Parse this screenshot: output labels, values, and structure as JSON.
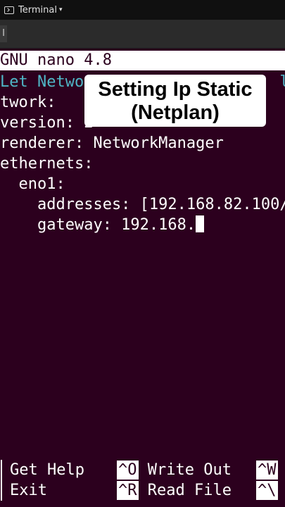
{
  "topbar": {
    "app_name": "Terminal",
    "caret": "▾",
    "icon": "terminal-icon"
  },
  "tab": {
    "fragment": "l"
  },
  "nano": {
    "title": "GNU nano 4.8"
  },
  "editor": {
    "lines": [
      "Let Netwo                     ll",
      "twork:",
      "version: 2",
      "renderer: NetworkManager",
      "ethernets:",
      "  eno1:",
      "    addresses: [192.168.82.100/",
      "    gateway: 192.168."
    ]
  },
  "caption": {
    "line1": "Setting Ip Static",
    "line2": "(Netplan)"
  },
  "footer": {
    "get_help": "Get Help",
    "exit": "Exit",
    "write_out_key": "^O",
    "write_out": "Write Out",
    "read_file_key": "^R",
    "read_file": "Read File",
    "where_is_key": "^W",
    "replace_key": "^\\"
  },
  "colors": {
    "background": "#2c001e",
    "comment": "#4fb6c6",
    "titlebar": "#ffffff"
  }
}
